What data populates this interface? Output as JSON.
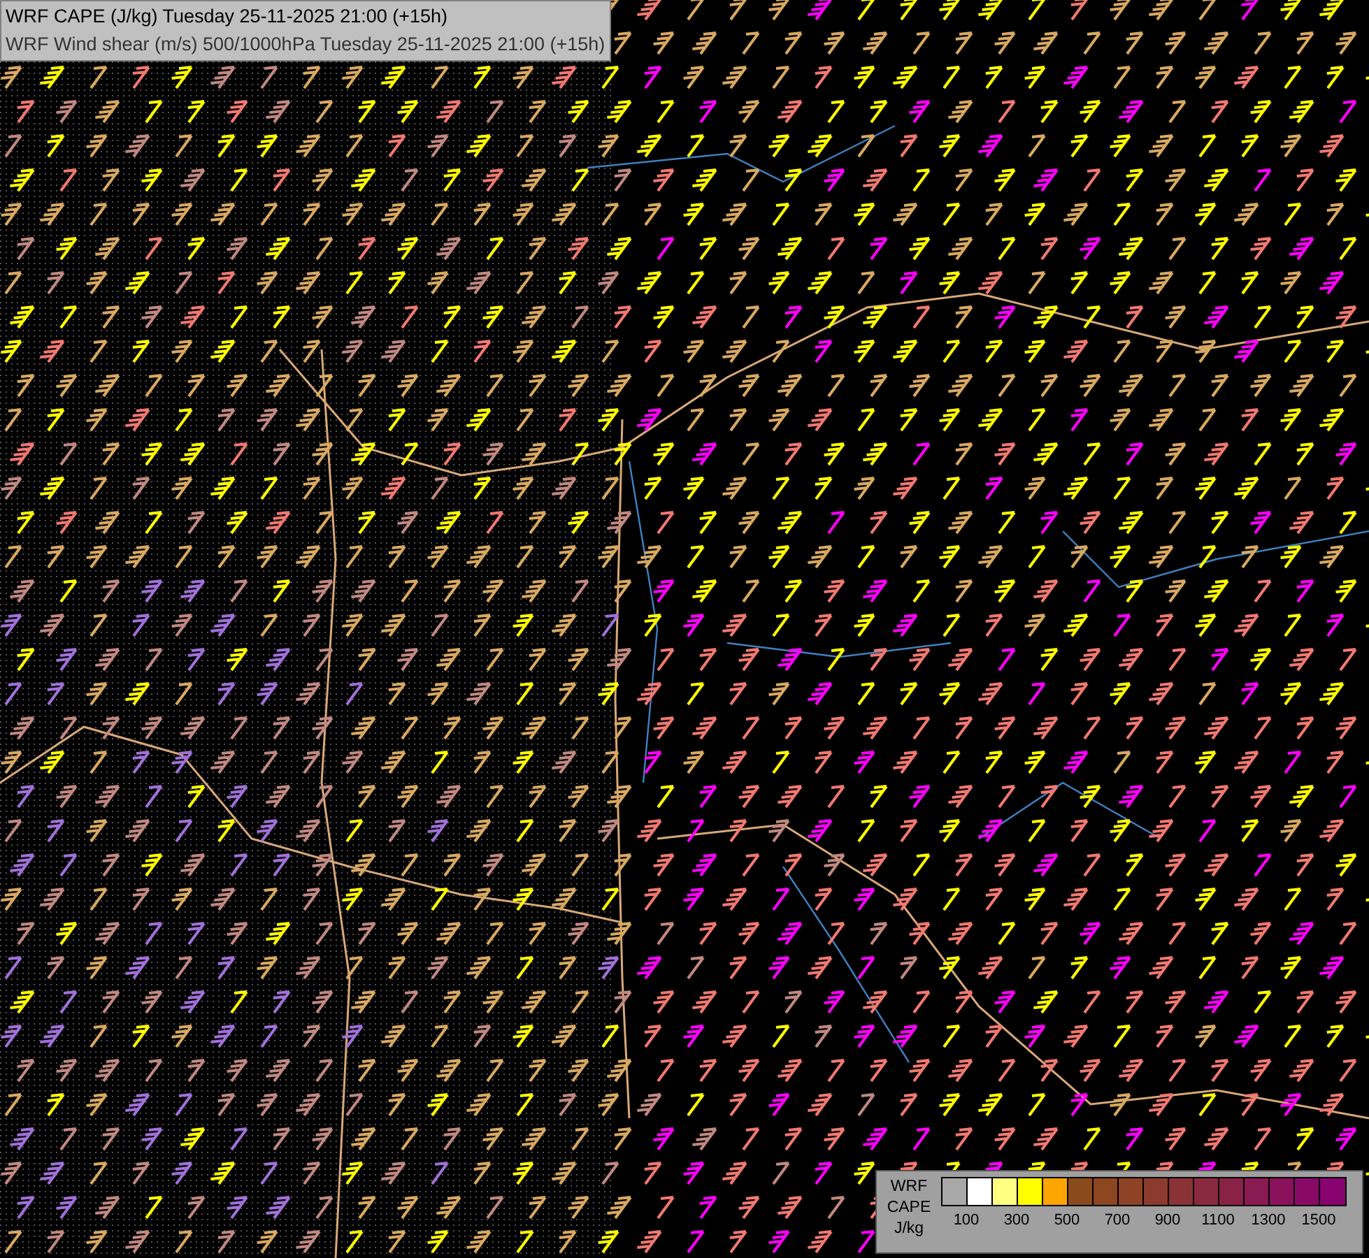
{
  "title_box": {
    "lines": [
      "WRF CAPE (J/kg) Tuesday 25-11-2025 21:00 (+15h)",
      "WRF Wind shear (m/s) 500/1000hPa Tuesday 25-11-2025 21:00 (+15h)"
    ]
  },
  "legend": {
    "label_lines": [
      "WRF",
      "CAPE",
      "J/kg"
    ],
    "swatches": [
      {
        "color": "#a8a8a8"
      },
      {
        "color": "#ffffff"
      },
      {
        "color": "#ffff80"
      },
      {
        "color": "#ffff00"
      },
      {
        "color": "#ffa500"
      },
      {
        "color": "#8b4a1c"
      },
      {
        "color": "#8c4620"
      },
      {
        "color": "#8e4226"
      },
      {
        "color": "#8c3a2e"
      },
      {
        "color": "#8a3236"
      },
      {
        "color": "#8a2a40"
      },
      {
        "color": "#8a2248"
      },
      {
        "color": "#8a1a52"
      },
      {
        "color": "#8a125c"
      },
      {
        "color": "#890a66"
      },
      {
        "color": "#880270"
      }
    ],
    "ticks": [
      "100",
      "300",
      "500",
      "700",
      "900",
      "1100",
      "1300",
      "1500"
    ]
  }
}
